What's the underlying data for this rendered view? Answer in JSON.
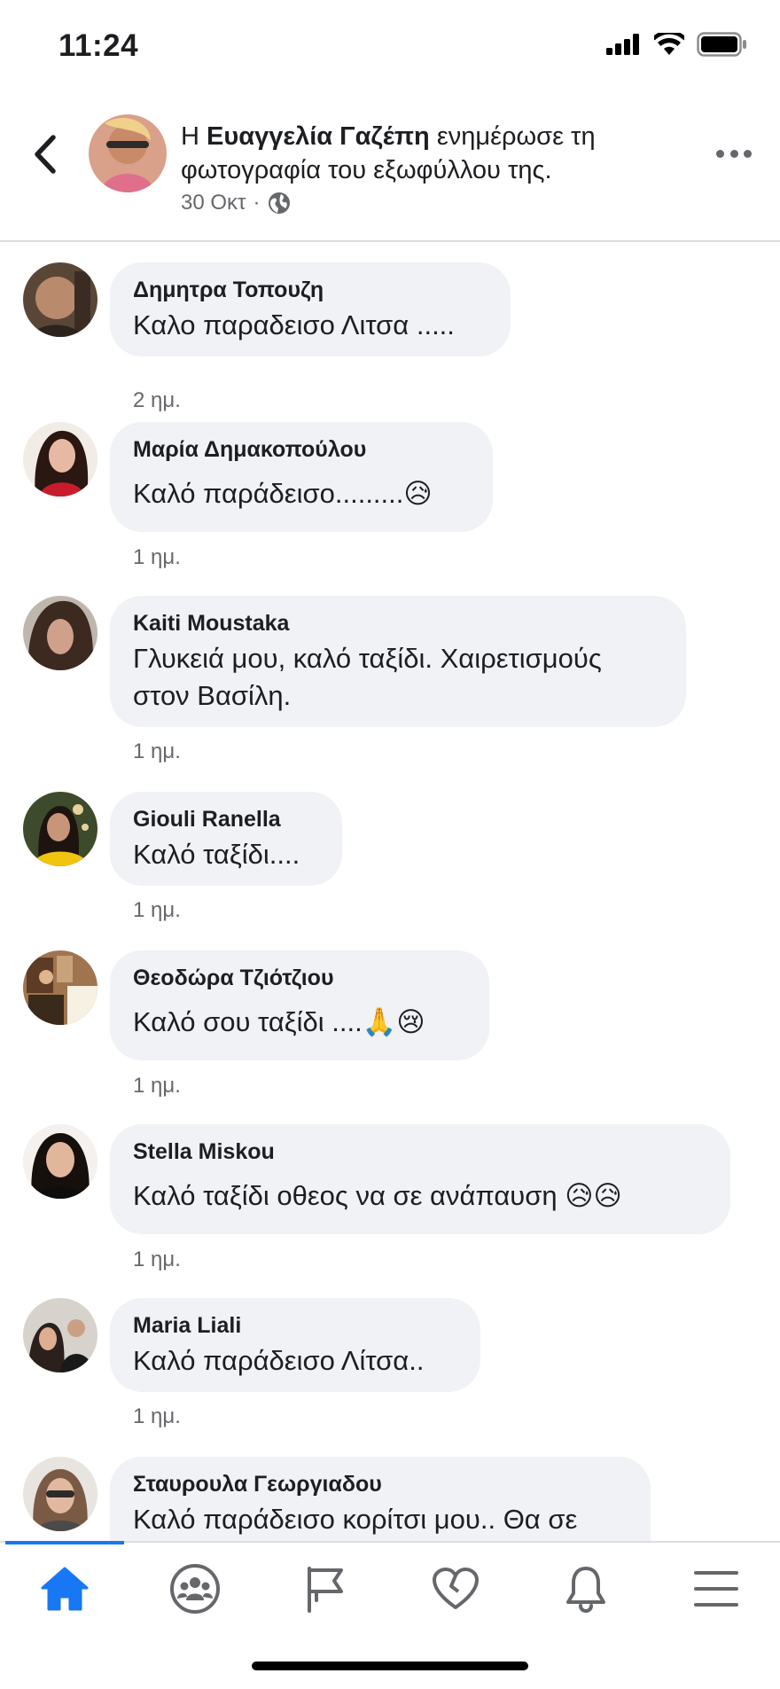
{
  "status_bar": {
    "time": "11:24"
  },
  "header": {
    "prefix": "Η",
    "author": "Ευαγγελία Γαζέπη",
    "action": "ενημέρωσε τη φωτογραφία του εξωφύλλου της.",
    "date": "30 Οκτ",
    "separator": "·"
  },
  "comments": [
    {
      "name": "Δημητρα Τοπουζη",
      "text": "Καλο παραδεισο Λιτσα .....",
      "time": "2 ημ."
    },
    {
      "name": "Μαρία Δημακοπούλου",
      "text": "Καλό παράδεισο.........😥",
      "time": "1 ημ."
    },
    {
      "name": "Kaiti Moustaka",
      "text": "Γλυκειά μου, καλό ταξίδι. Χαιρετισμούς στον Βασίλη.",
      "time": "1 ημ."
    },
    {
      "name": "Giouli Ranella",
      "text": "Καλό ταξίδι....",
      "time": "1 ημ."
    },
    {
      "name": "Θεοδώρα Τζιότζιου",
      "text": "Καλό σου ταξίδι ....🙏😢",
      "time": "1 ημ."
    },
    {
      "name": "Stella Miskou",
      "text": "Καλό ταξίδι  οθεος να σε  ανάπαυση 😥😥",
      "time": "1 ημ."
    },
    {
      "name": "Maria Liali",
      "text": "Καλό παράδεισο Λίτσα..",
      "time": "1 ημ."
    },
    {
      "name": "Σταυρουλα Γεωργιαδου",
      "text": "Καλό παράδεισο κορίτσι μου.. Θα σε",
      "time": ""
    }
  ],
  "tabs": [
    "home-icon",
    "groups-icon",
    "pages-flag-icon",
    "dating-heart-icon",
    "notifications-bell-icon",
    "menu-icon"
  ],
  "colors": {
    "accent": "#1877f2",
    "bubble": "#f0f2f5",
    "secondary_text": "#65676b"
  }
}
